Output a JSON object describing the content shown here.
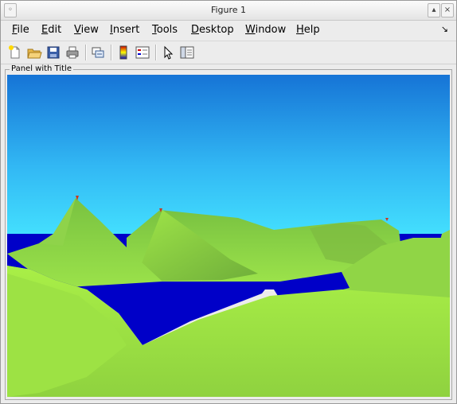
{
  "window": {
    "title": "Figure 1"
  },
  "menubar": {
    "items": [
      {
        "underline": "F",
        "rest": "ile"
      },
      {
        "underline": "E",
        "rest": "dit"
      },
      {
        "underline": "V",
        "rest": "iew"
      },
      {
        "underline": "I",
        "rest": "nsert"
      },
      {
        "underline": "T",
        "rest": "ools"
      },
      {
        "underline": "D",
        "rest": "esktop"
      },
      {
        "underline": "W",
        "rest": "indow"
      },
      {
        "underline": "H",
        "rest": "elp"
      }
    ]
  },
  "toolbar": {
    "buttons": [
      "new-figure-icon",
      "open-file-icon",
      "save-icon",
      "print-icon",
      "link-plot-icon",
      "colorbar-icon",
      "legend-icon",
      "edit-plot-arrow-icon",
      "property-editor-icon"
    ]
  },
  "panel": {
    "title": "Panel with Title"
  },
  "colors": {
    "sky_top": "#1674d6",
    "sky_horizon": "#45e3ff",
    "water": "#0000c8",
    "land_light": "#a4ea45",
    "land_dark": "#6fb83a"
  }
}
